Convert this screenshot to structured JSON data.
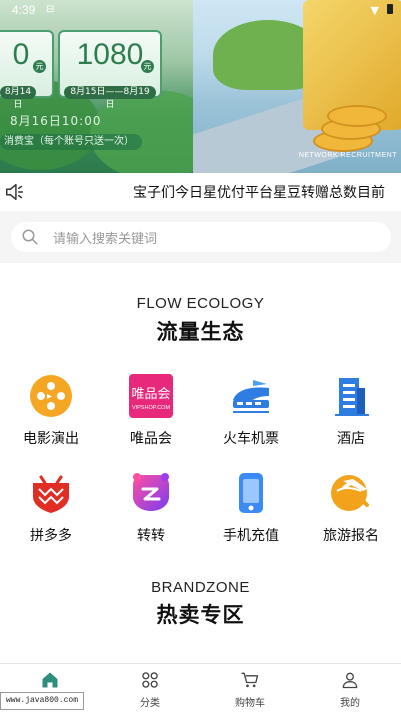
{
  "status_bar": {
    "time": "4:39",
    "sim_icon": "sim-icon",
    "wifi_icon": "wifi-icon",
    "battery_icon": "battery-icon"
  },
  "banner": {
    "ticket1_value": "0",
    "ticket2_value": "1080",
    "yuan": "元",
    "date1": "8月14日",
    "date2": "8月15日——8月19日",
    "time_text": "8月16日10:00",
    "note": "消费宝（每个账号只送一次）",
    "caption": "NETWORK RECRUITMENT"
  },
  "notice": {
    "icon": "speaker-icon",
    "text": "宝子们今日星优付平台星豆转赠总数目前"
  },
  "search": {
    "placeholder": "请输入搜索关键词"
  },
  "flow_section": {
    "title_en": "FLOW ECOLOGY",
    "title_cn": "流量生态"
  },
  "grid": [
    {
      "label": "电影演出",
      "icon": "film-icon",
      "color": "#f5a623"
    },
    {
      "label": "唯品会",
      "icon": "vipshop-icon",
      "color": "#e8287a",
      "logo_text": "唯品会",
      "logo_sub": "VIPSHOP.COM"
    },
    {
      "label": "火车机票",
      "icon": "train-icon",
      "color": "#2f7de1"
    },
    {
      "label": "酒店",
      "icon": "hotel-icon",
      "color": "#2f7de1"
    },
    {
      "label": "拼多多",
      "icon": "pinduoduo-icon",
      "color": "#e02e24"
    },
    {
      "label": "转转",
      "icon": "zhuanzhuan-icon",
      "color": "#9b3df2"
    },
    {
      "label": "手机充值",
      "icon": "phone-recharge-icon",
      "color": "#3b8af5"
    },
    {
      "label": "旅游报名",
      "icon": "travel-icon",
      "color": "#f3a21b"
    }
  ],
  "brand_section": {
    "title_en": "BRANDZONE",
    "title_cn": "热卖专区"
  },
  "tabbar": [
    {
      "label": "首页",
      "icon": "home-icon",
      "active": true
    },
    {
      "label": "分类",
      "icon": "category-icon",
      "active": false
    },
    {
      "label": "购物车",
      "icon": "cart-icon",
      "active": false
    },
    {
      "label": "我的",
      "icon": "user-icon",
      "active": false
    }
  ],
  "watermark": "www.java800.com",
  "colors": {
    "accent": "#2f8d7e",
    "background": "#f5f5f5"
  }
}
